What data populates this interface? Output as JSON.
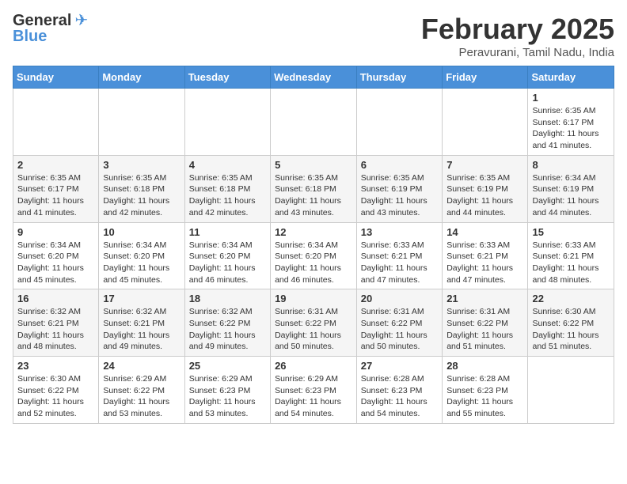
{
  "logo": {
    "text_general": "General",
    "text_blue": "Blue"
  },
  "title": "February 2025",
  "subtitle": "Peravurani, Tamil Nadu, India",
  "days_of_week": [
    "Sunday",
    "Monday",
    "Tuesday",
    "Wednesday",
    "Thursday",
    "Friday",
    "Saturday"
  ],
  "weeks": [
    [
      {
        "day": "",
        "info": ""
      },
      {
        "day": "",
        "info": ""
      },
      {
        "day": "",
        "info": ""
      },
      {
        "day": "",
        "info": ""
      },
      {
        "day": "",
        "info": ""
      },
      {
        "day": "",
        "info": ""
      },
      {
        "day": "1",
        "info": "Sunrise: 6:35 AM\nSunset: 6:17 PM\nDaylight: 11 hours\nand 41 minutes."
      }
    ],
    [
      {
        "day": "2",
        "info": "Sunrise: 6:35 AM\nSunset: 6:17 PM\nDaylight: 11 hours\nand 41 minutes."
      },
      {
        "day": "3",
        "info": "Sunrise: 6:35 AM\nSunset: 6:18 PM\nDaylight: 11 hours\nand 42 minutes."
      },
      {
        "day": "4",
        "info": "Sunrise: 6:35 AM\nSunset: 6:18 PM\nDaylight: 11 hours\nand 42 minutes."
      },
      {
        "day": "5",
        "info": "Sunrise: 6:35 AM\nSunset: 6:18 PM\nDaylight: 11 hours\nand 43 minutes."
      },
      {
        "day": "6",
        "info": "Sunrise: 6:35 AM\nSunset: 6:19 PM\nDaylight: 11 hours\nand 43 minutes."
      },
      {
        "day": "7",
        "info": "Sunrise: 6:35 AM\nSunset: 6:19 PM\nDaylight: 11 hours\nand 44 minutes."
      },
      {
        "day": "8",
        "info": "Sunrise: 6:34 AM\nSunset: 6:19 PM\nDaylight: 11 hours\nand 44 minutes."
      }
    ],
    [
      {
        "day": "9",
        "info": "Sunrise: 6:34 AM\nSunset: 6:20 PM\nDaylight: 11 hours\nand 45 minutes."
      },
      {
        "day": "10",
        "info": "Sunrise: 6:34 AM\nSunset: 6:20 PM\nDaylight: 11 hours\nand 45 minutes."
      },
      {
        "day": "11",
        "info": "Sunrise: 6:34 AM\nSunset: 6:20 PM\nDaylight: 11 hours\nand 46 minutes."
      },
      {
        "day": "12",
        "info": "Sunrise: 6:34 AM\nSunset: 6:20 PM\nDaylight: 11 hours\nand 46 minutes."
      },
      {
        "day": "13",
        "info": "Sunrise: 6:33 AM\nSunset: 6:21 PM\nDaylight: 11 hours\nand 47 minutes."
      },
      {
        "day": "14",
        "info": "Sunrise: 6:33 AM\nSunset: 6:21 PM\nDaylight: 11 hours\nand 47 minutes."
      },
      {
        "day": "15",
        "info": "Sunrise: 6:33 AM\nSunset: 6:21 PM\nDaylight: 11 hours\nand 48 minutes."
      }
    ],
    [
      {
        "day": "16",
        "info": "Sunrise: 6:32 AM\nSunset: 6:21 PM\nDaylight: 11 hours\nand 48 minutes."
      },
      {
        "day": "17",
        "info": "Sunrise: 6:32 AM\nSunset: 6:21 PM\nDaylight: 11 hours\nand 49 minutes."
      },
      {
        "day": "18",
        "info": "Sunrise: 6:32 AM\nSunset: 6:22 PM\nDaylight: 11 hours\nand 49 minutes."
      },
      {
        "day": "19",
        "info": "Sunrise: 6:31 AM\nSunset: 6:22 PM\nDaylight: 11 hours\nand 50 minutes."
      },
      {
        "day": "20",
        "info": "Sunrise: 6:31 AM\nSunset: 6:22 PM\nDaylight: 11 hours\nand 50 minutes."
      },
      {
        "day": "21",
        "info": "Sunrise: 6:31 AM\nSunset: 6:22 PM\nDaylight: 11 hours\nand 51 minutes."
      },
      {
        "day": "22",
        "info": "Sunrise: 6:30 AM\nSunset: 6:22 PM\nDaylight: 11 hours\nand 51 minutes."
      }
    ],
    [
      {
        "day": "23",
        "info": "Sunrise: 6:30 AM\nSunset: 6:22 PM\nDaylight: 11 hours\nand 52 minutes."
      },
      {
        "day": "24",
        "info": "Sunrise: 6:29 AM\nSunset: 6:22 PM\nDaylight: 11 hours\nand 53 minutes."
      },
      {
        "day": "25",
        "info": "Sunrise: 6:29 AM\nSunset: 6:23 PM\nDaylight: 11 hours\nand 53 minutes."
      },
      {
        "day": "26",
        "info": "Sunrise: 6:29 AM\nSunset: 6:23 PM\nDaylight: 11 hours\nand 54 minutes."
      },
      {
        "day": "27",
        "info": "Sunrise: 6:28 AM\nSunset: 6:23 PM\nDaylight: 11 hours\nand 54 minutes."
      },
      {
        "day": "28",
        "info": "Sunrise: 6:28 AM\nSunset: 6:23 PM\nDaylight: 11 hours\nand 55 minutes."
      },
      {
        "day": "",
        "info": ""
      }
    ]
  ]
}
